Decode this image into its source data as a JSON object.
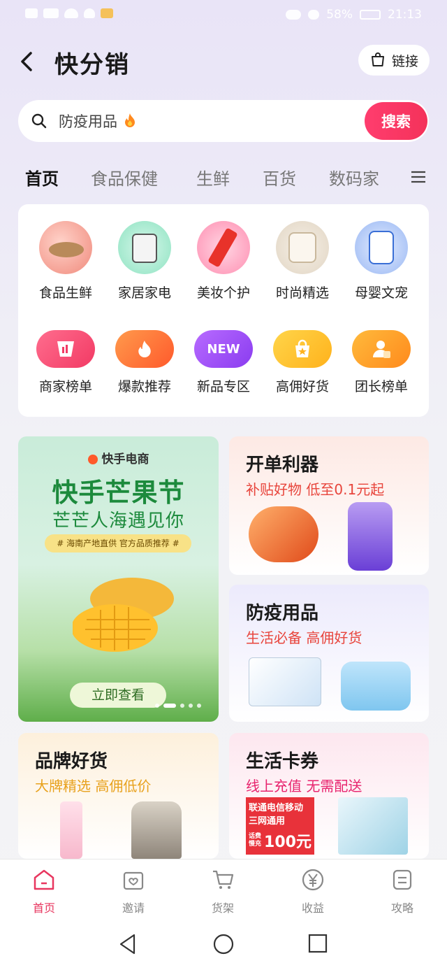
{
  "status_bar": {
    "battery": "58%",
    "time": "21:13"
  },
  "header": {
    "title": "快分销",
    "link_label": "链接"
  },
  "search": {
    "placeholder": "防疫用品",
    "button": "搜索"
  },
  "tabs": [
    "首页",
    "食品保健",
    "生鲜",
    "百货",
    "数码家"
  ],
  "categories_row1": [
    "食品生鲜",
    "家居家电",
    "美妆个护",
    "时尚精选",
    "母婴文宠"
  ],
  "categories_row2": [
    "商家榜单",
    "爆款推荐",
    "新品专区",
    "高佣好货",
    "团长榜单"
  ],
  "new_badge": "NEW",
  "banner": {
    "brand": "快手电商",
    "title": "快手芒果节",
    "subtitle": "芒芒人海遇见你",
    "tag": "# 海南产地直供 官方品质推荐 #",
    "cta": "立即查看"
  },
  "cards": [
    {
      "title": "开单利器",
      "subtitle": "补贴好物 低至0.1元起"
    },
    {
      "title": "防疫用品",
      "subtitle": "生活必备 高佣好货"
    },
    {
      "title": "品牌好货",
      "subtitle": "大牌精选 高佣低价"
    },
    {
      "title": "生活卡券",
      "subtitle": "线上充值 无需配送"
    }
  ],
  "voucher": {
    "line1": "联通电信移动",
    "line2": "三网通用",
    "small": "话费\n慢充",
    "amount": "100元"
  },
  "bottom_nav": [
    "首页",
    "邀请",
    "货架",
    "收益",
    "攻略"
  ],
  "colors": {
    "accent": "#e8365f",
    "search_button": "#f4325a"
  }
}
